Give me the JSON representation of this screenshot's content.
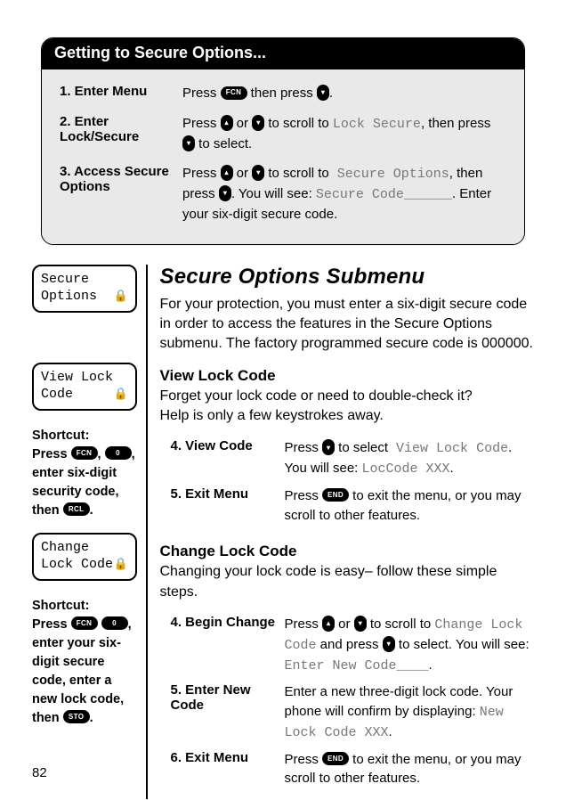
{
  "topCard": {
    "title": "Getting to Secure Options...",
    "steps": [
      {
        "n": "1.",
        "label": "Enter Menu",
        "desc": [
          "Press ",
          {
            "key": "oval",
            "t": "FCN"
          },
          " then press ",
          {
            "key": "circle",
            "t": "▾"
          },
          "."
        ]
      },
      {
        "n": "2.",
        "label": "Enter Lock/Secure",
        "desc": [
          "Press ",
          {
            "key": "circle",
            "t": "▴"
          },
          " or ",
          {
            "key": "circle",
            "t": "▾"
          },
          " to scroll to ",
          {
            "mono": "Lock Secure"
          },
          ", then press ",
          {
            "key": "circle",
            "t": "▾"
          },
          " to select."
        ]
      },
      {
        "n": "3.",
        "label": "Access Secure Options",
        "desc": [
          "Press ",
          {
            "key": "circle",
            "t": "▴"
          },
          " or ",
          {
            "key": "circle",
            "t": "▾"
          },
          " to scroll to",
          {
            "mono": " Secure Options"
          },
          ", then press ",
          {
            "key": "circle",
            "t": "▾"
          },
          ". You will see: ",
          {
            "mono": "Secure Code______"
          },
          ". Enter your six-digit secure code."
        ]
      }
    ]
  },
  "sidebar": {
    "screens": [
      {
        "line1": "Secure",
        "line2": "Options",
        "lock": true,
        "spacerBefore": 0
      },
      {
        "line1": "View Lock",
        "line2": "Code",
        "lock": true,
        "spacerBefore": 38
      },
      {
        "line1": "Change",
        "line2": "Lock Code",
        "lock": true,
        "spacerBefore": 0
      }
    ],
    "shortcut1": {
      "title": "Shortcut:",
      "parts": [
        "Press ",
        {
          "key": "oval",
          "t": "FCN"
        },
        ", ",
        {
          "key": "oval",
          "t": "0"
        },
        ", enter six-digit security code, then ",
        {
          "key": "oval",
          "t": "RCL"
        },
        "."
      ]
    },
    "shortcut2": {
      "title": "Shortcut:",
      "parts": [
        "Press ",
        {
          "key": "oval",
          "t": "FCN"
        },
        " ",
        {
          "key": "oval",
          "t": "0"
        },
        ", enter your six-digit secure code, enter a new lock code, then ",
        {
          "key": "oval",
          "t": "STO"
        },
        "."
      ]
    }
  },
  "main": {
    "sectionTitle": "Secure Options Submenu",
    "intro": "For your protection, you must enter a six-digit secure code in order to access the features in the Secure Options submenu. The factory programmed secure code is 000000.",
    "viewLock": {
      "heading": "View Lock Code",
      "body": "Forget your lock code or need to double-check it?\nHelp is only a few keystrokes away.",
      "steps": [
        {
          "n": "4.",
          "label": "View Code",
          "desc": [
            "Press ",
            {
              "key": "circle",
              "t": "▾"
            },
            " to select",
            {
              "mono": " View Lock Code"
            },
            ". You will see: ",
            {
              "mono": "LocCode XXX"
            },
            "."
          ]
        },
        {
          "n": "5.",
          "label": "Exit Menu",
          "desc": [
            "Press ",
            {
              "key": "oval",
              "t": "END"
            },
            " to exit the menu, or you may scroll to other features."
          ]
        }
      ]
    },
    "changeLock": {
      "heading": "Change Lock Code",
      "body": "Changing your lock code is easy– follow these simple steps.",
      "steps": [
        {
          "n": "4.",
          "label": "Begin Change",
          "desc": [
            "Press ",
            {
              "key": "circle",
              "t": "▴"
            },
            " or ",
            {
              "key": "circle",
              "t": "▾"
            },
            " to scroll to ",
            {
              "mono": "Change Lock Code"
            },
            " and press ",
            {
              "key": "circle",
              "t": "▾"
            },
            " to select. You will see:  ",
            {
              "mono": "Enter New Code____"
            },
            "."
          ]
        },
        {
          "n": "5.",
          "label": "Enter New Code",
          "desc": [
            "Enter a new three-digit lock code. Your phone will confirm by displaying: ",
            {
              "mono": "New Lock Code XXX"
            },
            "."
          ]
        },
        {
          "n": "6.",
          "label": "Exit Menu",
          "desc": [
            "Press ",
            {
              "key": "oval",
              "t": "END"
            },
            " to exit the menu, or you may scroll to other features."
          ]
        }
      ]
    }
  },
  "pageNumber": "82"
}
